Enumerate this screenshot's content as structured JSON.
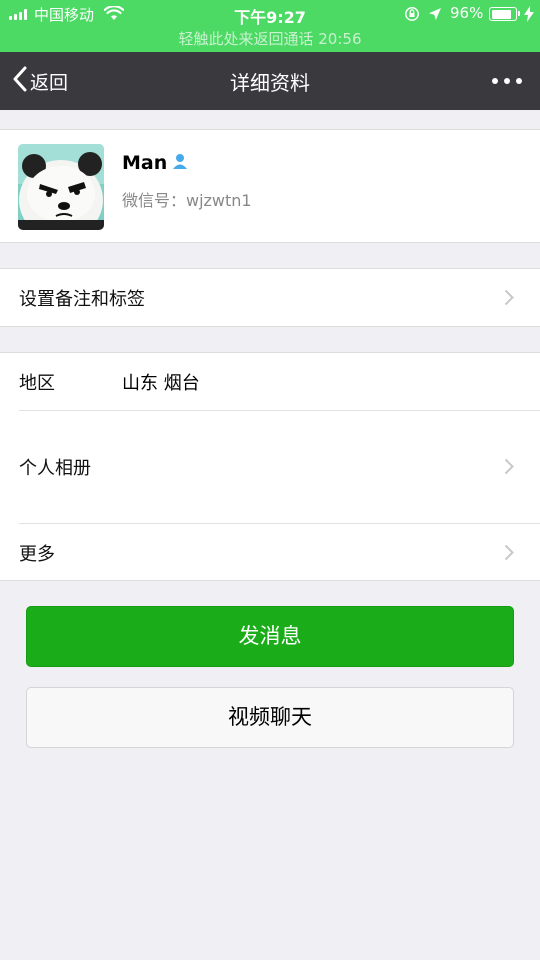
{
  "status_bar": {
    "carrier": "中国移动",
    "time": "下午9:27",
    "battery_percent": "96%",
    "battery_level": 0.96,
    "call_banner": "轻触此处来返回通话 20:56"
  },
  "nav": {
    "back_label": "返回",
    "title": "详细资料",
    "more_icon": "more-dots-icon"
  },
  "profile": {
    "name": "Man",
    "wechat_id": "微信号：wjzwtn1",
    "gender_icon": "male-person-icon"
  },
  "menu": {
    "remark_tags": "设置备注和标签",
    "region_label": "地区",
    "region_value": "山东 烟台",
    "album": "个人相册",
    "more": "更多"
  },
  "actions": {
    "send_message": "发消息",
    "video_chat": "视频聊天"
  },
  "colors": {
    "status_bg": "#4cd964",
    "nav_bg": "#3a393e",
    "primary": "#1aad19",
    "page_bg": "#efeff4"
  }
}
